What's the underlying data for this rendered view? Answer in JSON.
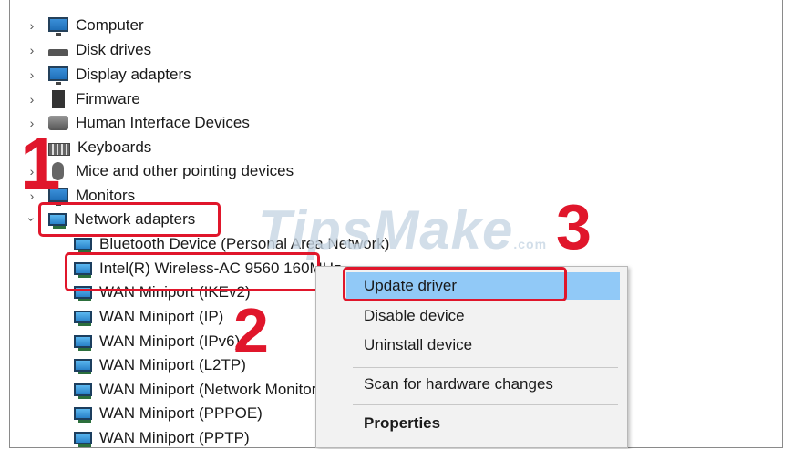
{
  "tree": {
    "categories": [
      {
        "label": "Computer",
        "expanded": false
      },
      {
        "label": "Disk drives",
        "expanded": false
      },
      {
        "label": "Display adapters",
        "expanded": false
      },
      {
        "label": "Firmware",
        "expanded": false
      },
      {
        "label": "Human Interface Devices",
        "expanded": false
      },
      {
        "label": "Keyboards",
        "expanded": false
      },
      {
        "label": "Mice and other pointing devices",
        "expanded": false
      },
      {
        "label": "Monitors",
        "expanded": false
      },
      {
        "label": "Network adapters",
        "expanded": true
      }
    ],
    "network_devices": [
      "Bluetooth Device (Personal Area Network)",
      "Intel(R) Wireless-AC 9560 160MHz",
      "WAN Miniport (IKEv2)",
      "WAN Miniport (IP)",
      "WAN Miniport (IPv6)",
      "WAN Miniport (L2TP)",
      "WAN Miniport (Network Monitor)",
      "WAN Miniport (PPPOE)",
      "WAN Miniport (PPTP)"
    ]
  },
  "context_menu": {
    "update_driver": "Update driver",
    "disable_device": "Disable device",
    "uninstall_device": "Uninstall device",
    "scan_hardware": "Scan for hardware changes",
    "properties": "Properties"
  },
  "annotations": {
    "step1": "1",
    "step2": "2",
    "step3": "3",
    "watermark": "TipsMake",
    "watermark_suffix": ".com",
    "highlight_color": "#e0162b"
  }
}
